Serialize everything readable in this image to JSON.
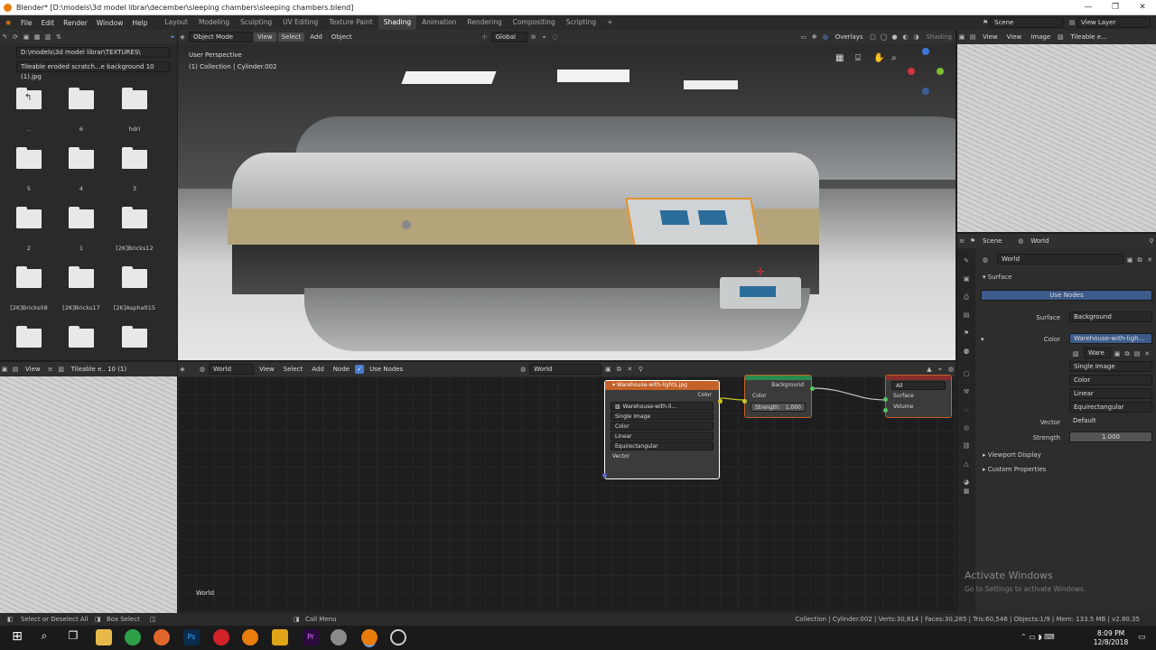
{
  "window": {
    "title": "Blender* [D:\\models\\3d model librar\\december\\sleeping chambers\\sleeping chambers.blend]"
  },
  "menu": [
    "File",
    "Edit",
    "Render",
    "Window",
    "Help"
  ],
  "workspaces": [
    "Layout",
    "Modeling",
    "Sculpting",
    "UV Editing",
    "Texture Paint",
    "Shading",
    "Animation",
    "Rendering",
    "Compositing",
    "Scripting"
  ],
  "active_workspace": "Shading",
  "scene": {
    "name": "Scene",
    "view_layer": "View Layer"
  },
  "file_browser": {
    "path": "D:\\models\\3d model librar\\TEXTURES\\",
    "file": "Tileable eroded scratch...e background 10 (1).jpg",
    "folders": [
      "..",
      "6",
      "hdri",
      "5",
      "4",
      "3",
      "2",
      "1",
      "[2K]Bricks12",
      "[2K]Bricks08",
      "[2K]Bricks17",
      "[2K]Asphalt15",
      "",
      "",
      ""
    ]
  },
  "viewport": {
    "mode": "Object Mode",
    "menu": [
      "View",
      "Select",
      "Add",
      "Object"
    ],
    "orientation": "Global",
    "overlays": "Overlays",
    "shading": "Shading",
    "perspective": "User Perspective",
    "collection": "(1) Collection | Cylinder.002"
  },
  "image_editor_top": {
    "menu": [
      "View",
      "View",
      "Image"
    ],
    "image": "Tileable e..."
  },
  "image_editor_left": {
    "menu": [
      "View"
    ],
    "image": "Tileable e.. 10 (1)"
  },
  "node_editor": {
    "menu": [
      "View",
      "Select",
      "Add",
      "Node"
    ],
    "world_select": "World",
    "use_nodes": "Use Nodes",
    "world_name": "World",
    "footer": "World",
    "image_node": {
      "title": "Warehouse-with-lights.jpg",
      "output": "Color",
      "image": "Warehouse-with-li...",
      "options": [
        "Single Image",
        "Color",
        "Linear",
        "Equirectangular"
      ],
      "input": "Vector"
    },
    "background_node": {
      "output": "Background",
      "color": "Color",
      "strength_label": "Strength:",
      "strength": "1.000"
    },
    "output_node": {
      "target": "All",
      "surface": "Surface",
      "volume": "Volume"
    }
  },
  "properties": {
    "tabs": [
      "Scene",
      "World"
    ],
    "world": "World",
    "section": "Surface",
    "use_nodes": "Use Nodes",
    "surface_label": "Surface",
    "surface": "Background",
    "color_label": "Color",
    "color": "Warehouse-with-ligh...",
    "image": "Ware",
    "options": [
      "Single Image",
      "Color",
      "Linear",
      "Equirectangular"
    ],
    "vector_label": "Vector",
    "vector": "Default",
    "strength_label": "Strength",
    "strength": "1.000",
    "viewport_display": "Viewport Display",
    "custom_properties": "Custom Properties"
  },
  "watermark": {
    "title": "Activate Windows",
    "sub": "Go to Settings to activate Windows."
  },
  "status": {
    "left1": "Select or Deselect All",
    "left2": "Box Select",
    "mid": "Call Menu",
    "right": "Collection | Cylinder.002 | Verts:30,814 | Faces:30,285 | Tris:60,546 | Objects:1/9 | Mem: 133.5 MB | v2.80.35"
  },
  "clock": {
    "time": "8:09 PM",
    "date": "12/8/2018"
  },
  "colors": {
    "accent": "#e87d0d",
    "selected": "#3d5b8a",
    "node_header": "#c4622a"
  }
}
